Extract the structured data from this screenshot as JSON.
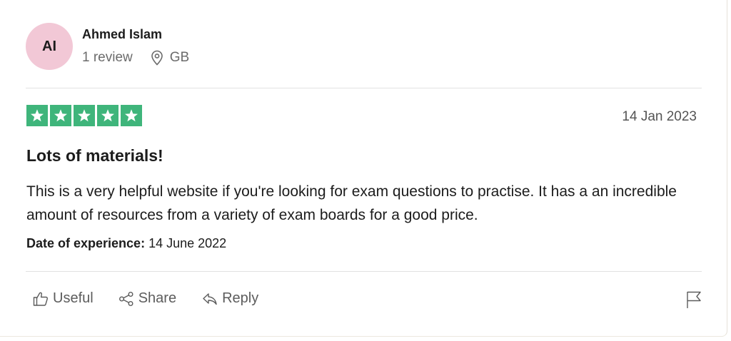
{
  "reviewer": {
    "initials": "AI",
    "name": "Ahmed Islam",
    "review_count": "1 review",
    "country": "GB",
    "avatar_color": "#f2c8d6"
  },
  "review": {
    "rating": 5,
    "max_rating": 5,
    "star_color": "#3fb57b",
    "date": "14 Jan 2023",
    "title": "Lots of materials!",
    "body": "This is a very helpful website if you're looking for exam questions to practise. It has a an incredible amount of resources from a variety of exam boards for a good price.",
    "experience_label": "Date of experience:",
    "experience_date": "14 June 2022"
  },
  "actions": {
    "useful_label": "Useful",
    "useful_icon": "thumbs-up-icon",
    "share_label": "Share",
    "share_icon": "share-icon",
    "reply_label": "Reply",
    "reply_icon": "reply-icon",
    "flag_icon": "flag-icon"
  }
}
